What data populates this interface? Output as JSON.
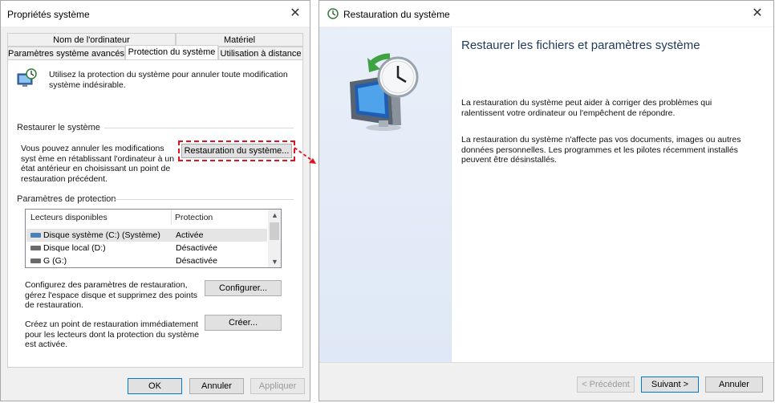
{
  "win1": {
    "title": "Propriétés système",
    "tabs_row1": [
      "Nom de l'ordinateur",
      "Matériel"
    ],
    "tabs_row2": [
      "Paramètres système avancés",
      "Protection du système",
      "Utilisation à distance"
    ],
    "intro_text": "Utilisez la protection du système pour annuler toute modification système indésirable.",
    "restore": {
      "section_label": "Restaurer le système",
      "description": "Vous pouvez annuler les modifications syst ème en rétablissant l'ordinateur à un état antérieur en choisissant un point de restauration précédent.",
      "button_label": "Restauration du système..."
    },
    "protection": {
      "section_label": "Paramètres de protection",
      "col_drives": "Lecteurs disponibles",
      "col_protection": "Protection",
      "rows": [
        {
          "drive": "Disque système (C:) (Système)",
          "status": "Activée"
        },
        {
          "drive": "Disque local (D:)",
          "status": "Désactivée"
        },
        {
          "drive": "G (G:)",
          "status": "Désactivée"
        }
      ]
    },
    "configure": {
      "text": "Configurez des paramètres de restauration, gérez l'espace disque et supprimez des points de restauration.",
      "button_label": "Configurer..."
    },
    "create": {
      "text": "Créez un point de restauration immédiatement pour les lecteurs dont la protection du système est activée.",
      "button_label": "Créer..."
    },
    "footer": {
      "ok": "OK",
      "cancel": "Annuler",
      "apply": "Appliquer"
    }
  },
  "win2": {
    "title": "Restauration du système",
    "heading": "Restaurer les fichiers et paramètres système",
    "para1": "La restauration du système peut aider à corriger des problèmes qui ralentissent votre ordinateur ou l'empêchent de répondre.",
    "para2": "La restauration du système n'affecte pas vos documents, images ou autres données personnelles. Les programmes et les pilotes récemment installés peuvent être désinstallés.",
    "footer": {
      "previous": "< Précédent",
      "next": "Suivant >",
      "cancel": "Annuler"
    }
  },
  "colors": {
    "highlight_dash": "#e0141e",
    "accent_blue": "#0078d7",
    "heading_color": "#1e395b"
  },
  "icons": [
    "system-protection-icon",
    "close-icon",
    "drive-icon",
    "system-restore-clock-icon",
    "arrow-icon"
  ]
}
